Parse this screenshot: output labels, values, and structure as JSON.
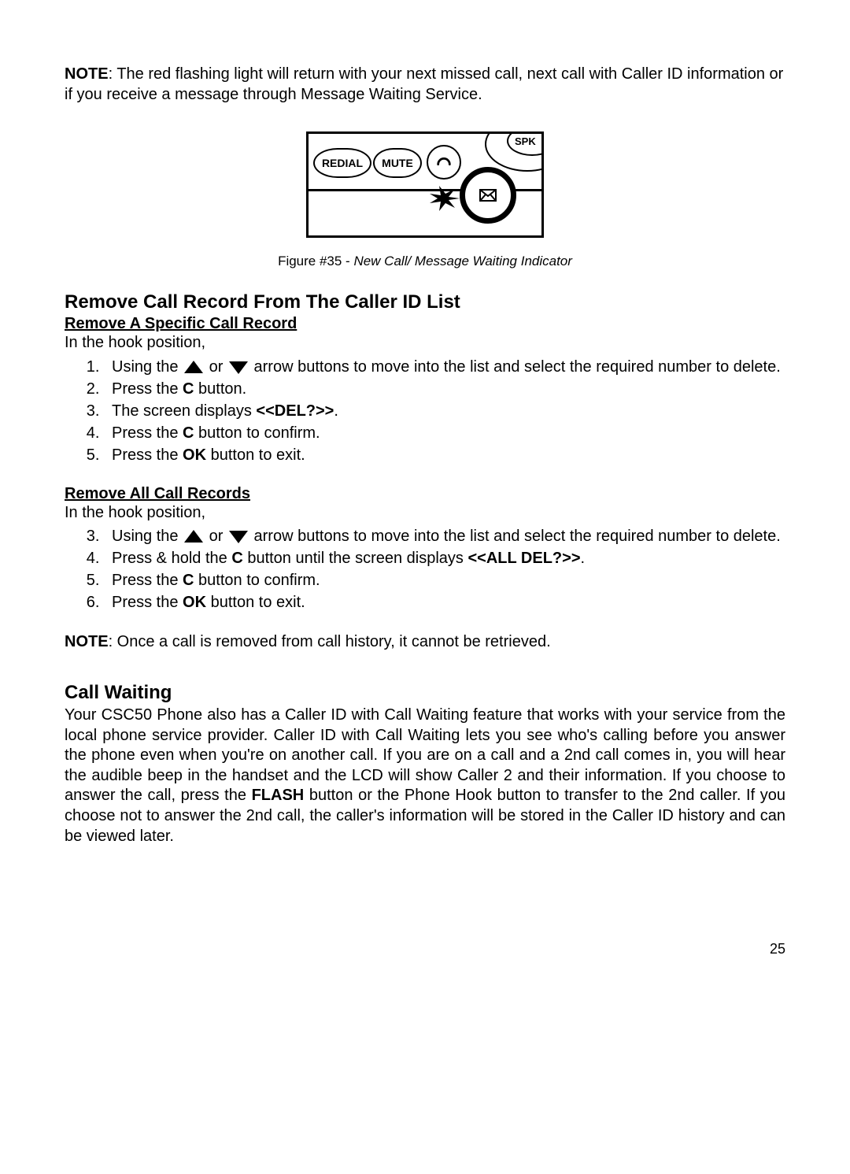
{
  "note1_label": "NOTE",
  "note1_text": ": The red flashing light will return with your next missed call, next call with Caller ID information or if you receive a message through Message Waiting Service.",
  "figure": {
    "redial": "REDIAL",
    "mute": "MUTE",
    "spk": "SPK",
    "handset": "☊",
    "envelope": "✉",
    "caption_prefix": "Figure #35 - ",
    "caption_italic": "New Call/ Message Waiting Indicator"
  },
  "section1_title": "Remove Call Record From The Caller ID List",
  "sub1_title": "Remove A Specific Call Record",
  "hook_text": "In the hook position,",
  "list1": {
    "i1a": "Using the ",
    "i1b": " or ",
    "i1c": " arrow buttons to move into the list and select the required number to delete.",
    "i2a": "Press the ",
    "i2b": "C",
    "i2c": " button.",
    "i3a": "The screen displays ",
    "i3b": "<<DEL?>>",
    "i3c": ".",
    "i4a": "Press the ",
    "i4b": "C",
    "i4c": " button to confirm.",
    "i5a": "Press the ",
    "i5b": "OK",
    "i5c": " button to exit."
  },
  "sub2_title": "Remove All Call Records ",
  "list2": {
    "i3a": "Using the ",
    "i3b": " or ",
    "i3c": " arrow buttons to move into the list and select the required number to delete.",
    "i4a": "Press  & hold the ",
    "i4b": "C",
    "i4c": " button until the screen displays ",
    "i4d": "<<ALL DEL?>>",
    "i4e": ".",
    "i5a": "Press the ",
    "i5b": "C",
    "i5c": " button to confirm.",
    "i6a": "Press the ",
    "i6b": "OK",
    "i6c": " button to exit."
  },
  "note2_label": "NOTE",
  "note2_text": ": Once a call is removed from call history, it cannot be retrieved.",
  "section2_title": "Call Waiting",
  "call_waiting_p1a": "Your CSC50 Phone also has a Caller ID with Call Waiting feature that works with your service from the local phone service provider. Caller ID with Call Waiting lets you see who's calling before you answer the phone even when you're on another call. If you are on a call and a 2nd call comes in, you will hear the audible beep in the handset and the LCD will show Caller 2 and their information.  If you choose to answer the call, press the ",
  "call_waiting_flash": "FLASH",
  "call_waiting_p1b": " button or the Phone Hook button to transfer to the 2nd caller. If you choose not to answer the 2nd call, the caller's information will be stored in the Caller ID history and can be viewed later.",
  "page_number": "25"
}
